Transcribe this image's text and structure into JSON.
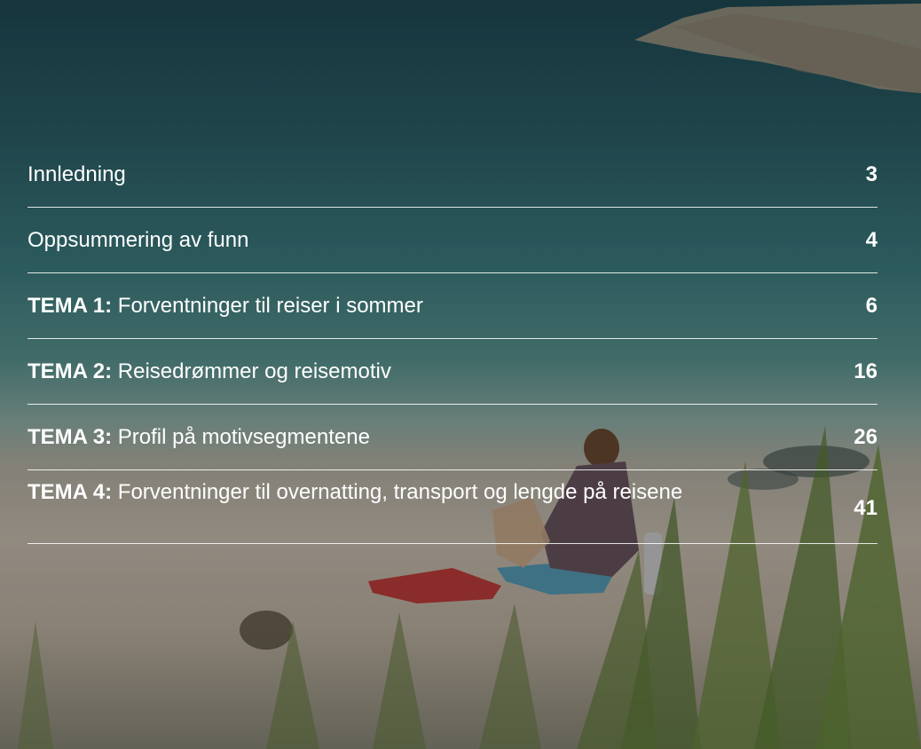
{
  "background": {
    "description_icon": "beach-photo",
    "overlay_color": "#000000"
  },
  "toc": {
    "items": [
      {
        "prefix": "",
        "title": "Innledning",
        "page": "3"
      },
      {
        "prefix": "",
        "title": "Oppsummering av funn",
        "page": "4"
      },
      {
        "prefix": "TEMA 1:",
        "title": " Forventninger til reiser i sommer",
        "page": "6"
      },
      {
        "prefix": "TEMA 2:",
        "title": " Reisedrømmer og reisemotiv",
        "page": "16"
      },
      {
        "prefix": "TEMA 3:",
        "title": " Profil på motivsegmentene",
        "page": "26"
      },
      {
        "prefix": "TEMA 4:",
        "title": " Forventninger til overnatting, transport og lengde på reisene",
        "page": "41"
      }
    ]
  }
}
